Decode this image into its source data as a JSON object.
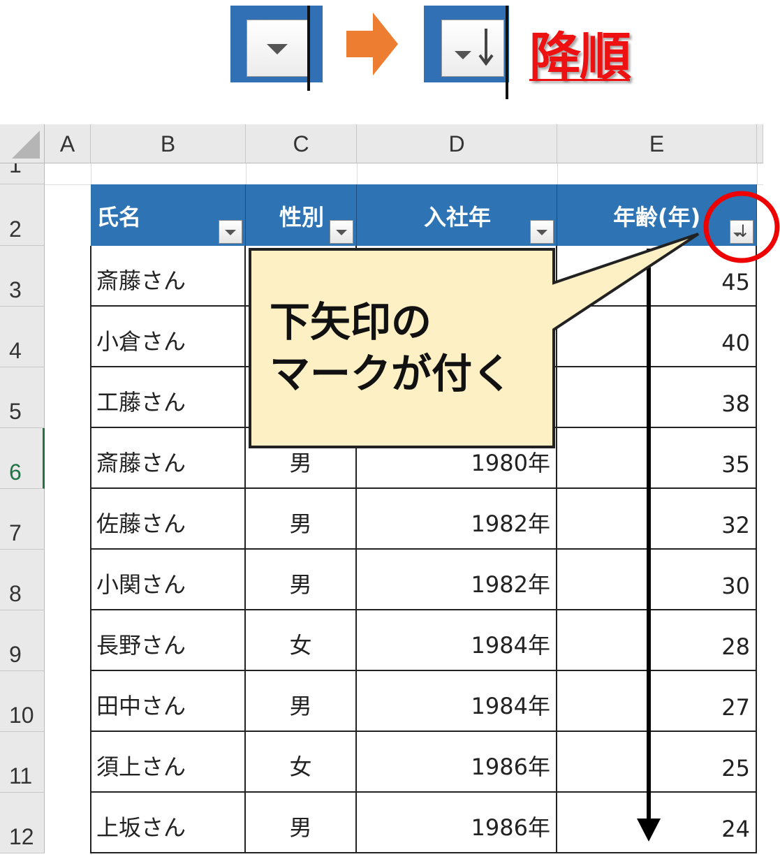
{
  "legend": {
    "label": "降順",
    "before_icon": "filter-dropdown-icon",
    "after_icon": "sort-descending-filter-icon",
    "arrow_icon": "orange-right-arrow-icon",
    "label_color": "#ee1111"
  },
  "sheet": {
    "columns": [
      "A",
      "B",
      "C",
      "D",
      "E"
    ],
    "rows": [
      "1",
      "2",
      "3",
      "4",
      "5",
      "6",
      "7",
      "8",
      "9",
      "10",
      "11",
      "12"
    ],
    "active_row": "6"
  },
  "table": {
    "headers": [
      "氏名",
      "性別",
      "入社年",
      "年齢(年)"
    ],
    "header_color": "#2e74b5",
    "rows": [
      {
        "name": "斎藤さん",
        "gender": "",
        "year": "",
        "age": "45"
      },
      {
        "name": "小倉さん",
        "gender": "",
        "year": "",
        "age": "40"
      },
      {
        "name": "工藤さん",
        "gender": "",
        "year": "",
        "age": "38"
      },
      {
        "name": "斎藤さん",
        "gender": "男",
        "year": "1980年",
        "age": "35"
      },
      {
        "name": "佐藤さん",
        "gender": "男",
        "year": "1982年",
        "age": "32"
      },
      {
        "name": "小関さん",
        "gender": "男",
        "year": "1982年",
        "age": "30"
      },
      {
        "name": "長野さん",
        "gender": "女",
        "year": "1984年",
        "age": "28"
      },
      {
        "name": "田中さん",
        "gender": "男",
        "year": "1984年",
        "age": "27"
      },
      {
        "name": "須上さん",
        "gender": "女",
        "year": "1986年",
        "age": "25"
      },
      {
        "name": "上坂さん",
        "gender": "男",
        "year": "1986年",
        "age": "24"
      }
    ]
  },
  "callout": {
    "line1": "下矢印の",
    "line2": "マークが付く",
    "fill": "#fdf0c4"
  }
}
